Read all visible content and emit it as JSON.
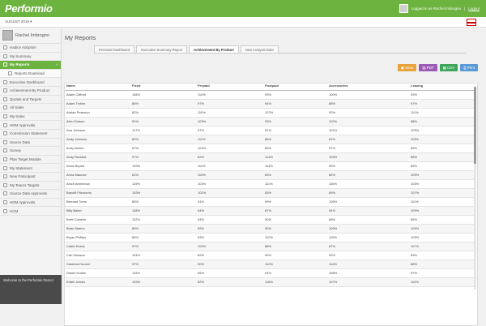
{
  "topbar": {
    "brand": "Performio",
    "logged_in": "Logged in as Rachel Imbrogno",
    "logout": "Logout"
  },
  "subbar": {
    "period": "AUGUST 2018 ▾"
  },
  "sidebar": {
    "user_name": "Rachel Imbrogno",
    "items": [
      {
        "label": "Hadice Adoption"
      },
      {
        "label": "My Summary"
      },
      {
        "label": "My Reports"
      },
      {
        "label": "Reports Download"
      },
      {
        "label": "Executive Dashboard"
      },
      {
        "label": "Achievement By Product"
      },
      {
        "label": "Quotas and Targets"
      },
      {
        "label": "All Sales"
      },
      {
        "label": "My Sales"
      },
      {
        "label": "HDM Approvals"
      },
      {
        "label": "Commission Statement"
      },
      {
        "label": "Source Data"
      },
      {
        "label": "Survey"
      },
      {
        "label": "Plan Target Module"
      },
      {
        "label": "My Statement"
      },
      {
        "label": "New Participant"
      },
      {
        "label": "My Teams Targets"
      },
      {
        "label": "Source Data Approvals"
      },
      {
        "label": "HDM Approvals"
      },
      {
        "label": "HCM"
      }
    ],
    "welcome": "Welcome to the Performio Demo!"
  },
  "main": {
    "title": "My Reports",
    "tabs": [
      {
        "label": "Personal Dashboard"
      },
      {
        "label": "Executive Summary Report"
      },
      {
        "label": "Achievement By Product"
      },
      {
        "label": "New Analysis Data"
      }
    ],
    "buttons": {
      "save": "Save",
      "pdf": "PDF",
      "csv": "CSV",
      "print": "Print"
    }
  },
  "table": {
    "headers": [
      "Name",
      "Fixed",
      "Prepaid",
      "Postpaid",
      "Accessories",
      "Leasing"
    ],
    "rows": [
      [
        "Adam Clifford",
        "116%",
        "114%",
        "93%",
        "100%",
        "93%"
      ],
      [
        "Adam Trotter",
        "86%",
        "97%",
        "94%",
        "88%",
        "97%"
      ],
      [
        "Adrian Peterson",
        "82%",
        "110%",
        "107%",
        "92%",
        "111%"
      ],
      [
        "Alvin Dotson",
        "91%",
        "103%",
        "93%",
        "112%",
        "88%"
      ],
      [
        "Ana Johnson",
        "117%",
        "97%",
        "91%",
        "101%",
        "103%"
      ],
      [
        "Andy Johnson",
        "82%",
        "111%",
        "88%",
        "81%",
        "113%"
      ],
      [
        "Andy Morris",
        "87%",
        "104%",
        "89%",
        "97%",
        "89%"
      ],
      [
        "Andy Raddick",
        "97%",
        "82%",
        "114%",
        "109%",
        "88%"
      ],
      [
        "Anna Bryant",
        "109%",
        "111%",
        "114%",
        "96%",
        "89%"
      ],
      [
        "Anna Maurice",
        "81%",
        "113%",
        "83%",
        "82%",
        "109%"
      ],
      [
        "Arlich Armintrow",
        "119%",
        "103%",
        "111%",
        "116%",
        "103%"
      ],
      [
        "Barclift Fitzmorris",
        "103%",
        "101%",
        "83%",
        "89%",
        "107%"
      ],
      [
        "Bernard Toms",
        "86%",
        "91%",
        "99%",
        "105%",
        "111%"
      ],
      [
        "Billy Baker",
        "118%",
        "94%",
        "87%",
        "94%",
        "109%"
      ],
      [
        "Brett Costello",
        "112%",
        "94%",
        "90%",
        "88%",
        "85%"
      ],
      [
        "Brian Marino",
        "86%",
        "99%",
        "90%",
        "109%",
        "104%"
      ],
      [
        "Bryan Phillips",
        "86%",
        "83%",
        "112%",
        "115%",
        "103%"
      ],
      [
        "Caleb Evans",
        "97%",
        "113%",
        "88%",
        "87%",
        "117%"
      ],
      [
        "Carl Hewson",
        "101%",
        "89%",
        "90%",
        "92%",
        "83%"
      ],
      [
        "Catarina Hoover",
        "97%",
        "90%",
        "112%",
        "114%",
        "88%"
      ],
      [
        "Daniel Hobbs",
        "119%",
        "96%",
        "94%",
        "106%",
        "97%"
      ],
      [
        "Eddie James",
        "104%",
        "82%",
        "118%",
        "107%",
        "114%"
      ]
    ]
  }
}
